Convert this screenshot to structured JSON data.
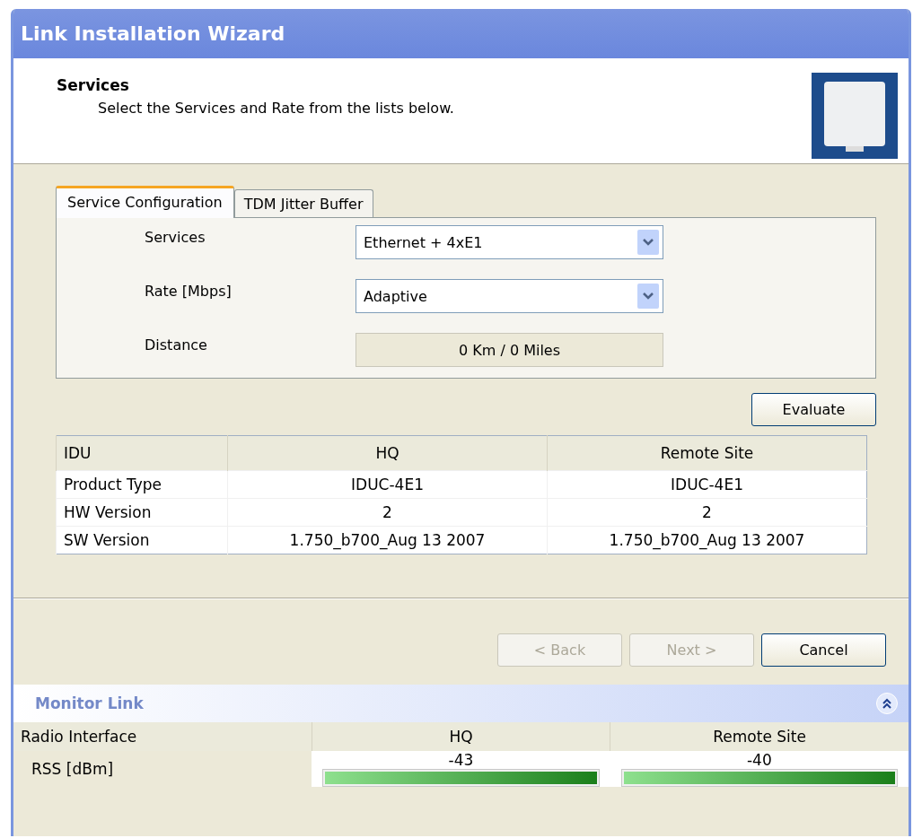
{
  "window": {
    "title": "Link Installation Wizard"
  },
  "header": {
    "title": "Services",
    "subtitle": "Select the Services and Rate from the lists below."
  },
  "tabs": [
    {
      "label": "Service Configuration",
      "selected": true
    },
    {
      "label": "TDM Jitter Buffer",
      "selected": false
    }
  ],
  "form": [
    {
      "label": "Services",
      "kind": "dropdown",
      "value": "Ethernet + 4xE1"
    },
    {
      "label": "Rate [Mbps]",
      "kind": "dropdown",
      "value": "Adaptive"
    },
    {
      "label": "Distance",
      "kind": "readonly",
      "value": "0 Km / 0 Miles"
    }
  ],
  "evaluate_button": "Evaluate",
  "idu_table": {
    "columns": [
      "IDU",
      "HQ",
      "Remote Site"
    ],
    "rows": [
      [
        "Product Type",
        "IDUC-4E1",
        "IDUC-4E1"
      ],
      [
        "HW Version",
        "2",
        "2"
      ],
      [
        "SW Version",
        "1.750_b700_Aug 13 2007",
        "1.750_b700_Aug 13 2007"
      ]
    ]
  },
  "buttons": [
    {
      "label": "< Back",
      "disabled": true
    },
    {
      "label": "Next >",
      "disabled": true
    },
    {
      "label": "Cancel",
      "disabled": false
    }
  ],
  "monitor": {
    "title": "Monitor Link",
    "columns": [
      "Radio Interface",
      "HQ",
      "Remote Site"
    ],
    "rows": [
      {
        "cells": [
          {
            "kind": "label",
            "text": "RSS [dBm]"
          },
          {
            "kind": "meter",
            "reading": "-43",
            "level": 1
          },
          {
            "kind": "meter",
            "reading": "-40",
            "level": 1
          }
        ]
      }
    ]
  }
}
